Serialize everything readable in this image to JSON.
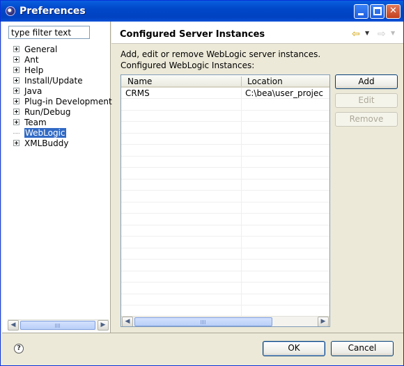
{
  "window": {
    "title": "Preferences"
  },
  "sidebar": {
    "filter_value": "type filter text",
    "items": [
      {
        "label": "General",
        "expandable": true,
        "selected": false
      },
      {
        "label": "Ant",
        "expandable": true,
        "selected": false
      },
      {
        "label": "Help",
        "expandable": true,
        "selected": false
      },
      {
        "label": "Install/Update",
        "expandable": true,
        "selected": false
      },
      {
        "label": "Java",
        "expandable": true,
        "selected": false
      },
      {
        "label": "Plug-in Development",
        "expandable": true,
        "selected": false
      },
      {
        "label": "Run/Debug",
        "expandable": true,
        "selected": false
      },
      {
        "label": "Team",
        "expandable": true,
        "selected": false
      },
      {
        "label": "WebLogic",
        "expandable": false,
        "selected": true
      },
      {
        "label": "XMLBuddy",
        "expandable": true,
        "selected": false
      }
    ]
  },
  "page": {
    "title": "Configured Server Instances",
    "description_line1": "Add, edit or remove WebLogic server instances.",
    "description_line2": "Configured WebLogic Instances:"
  },
  "table": {
    "columns": [
      "Name",
      "Location"
    ],
    "rows": [
      {
        "name": "CRMS",
        "location": "C:\\bea\\user_projec"
      }
    ]
  },
  "actions": {
    "add_label": "Add",
    "edit_label": "Edit",
    "remove_label": "Remove",
    "edit_enabled": false,
    "remove_enabled": false
  },
  "footer": {
    "ok_label": "OK",
    "cancel_label": "Cancel"
  },
  "colors": {
    "selection": "#316ac5",
    "titlebar": "#0047c8"
  }
}
